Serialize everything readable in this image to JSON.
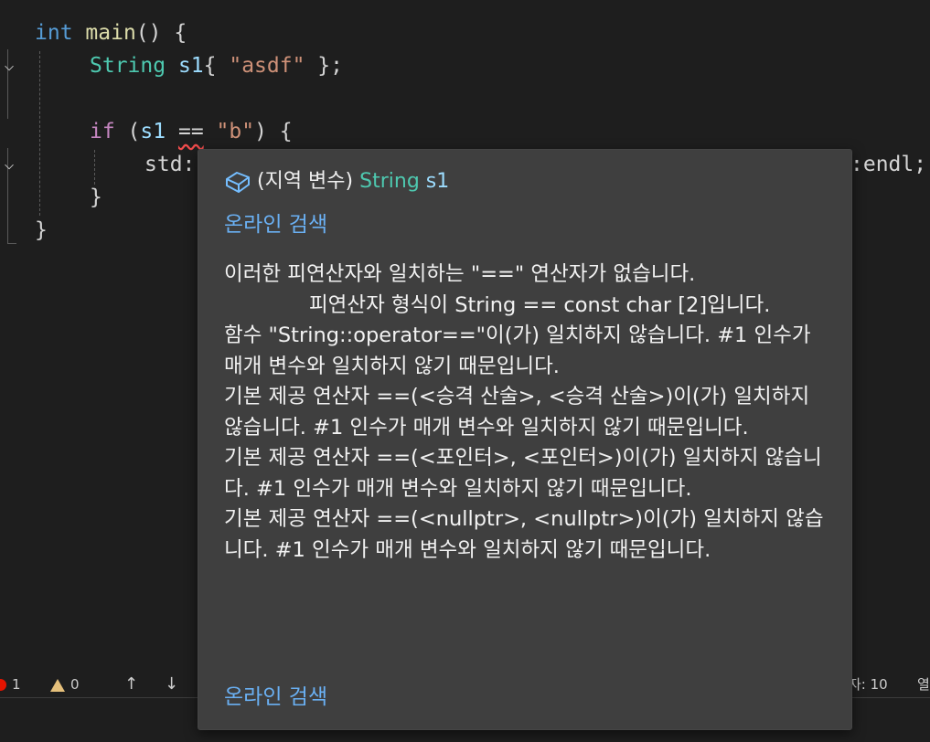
{
  "code": {
    "l1": {
      "kw": "int",
      "fn": "main",
      "rest": "() {"
    },
    "l2": {
      "type": "String",
      "var": "s1",
      "open": "{ ",
      "str": "\"asdf\"",
      "close": " };"
    },
    "l4": {
      "kw": "if",
      "open": " (",
      "var": "s1",
      "sp": " ",
      "op": "==",
      "sp2": " ",
      "str": "\"b\"",
      "close": ") {"
    },
    "l5": {
      "left": "std:",
      "right": ":endl;"
    },
    "l6": "}",
    "l7": "}"
  },
  "status": {
    "errors": "1",
    "warnings": "0",
    "up_arrow": "↑",
    "down_arrow": "↓",
    "position": "자: 10",
    "col_partial": "열"
  },
  "hover": {
    "icon": "cube-icon",
    "label": "(지역 변수)",
    "type": "String",
    "name": "s1",
    "link_top": "온라인 검색",
    "messages": [
      "이러한 피연산자와 일치하는 \"==\" 연산자가 없습니다.",
      "             피연산자 형식이 String == const char [2]입니다.",
      "함수 \"String::operator==\"이(가) 일치하지 않습니다. #1 인수가 매개 변수와 일치하지 않기 때문입니다.",
      "기본 제공 연산자 ==(<승격 산술>, <승격 산술>)이(가) 일치하지 않습니다. #1 인수가 매개 변수와 일치하지 않기 때문입니다.",
      "기본 제공 연산자 ==(<포인터>, <포인터>)이(가) 일치하지 않습니다. #1 인수가 매개 변수와 일치하지 않기 때문입니다.",
      "기본 제공 연산자 ==(<nullptr>, <nullptr>)이(가) 일치하지 않습니다. #1 인수가 매개 변수와 일치하지 않기 때문입니다."
    ],
    "link_bottom": "온라인 검색"
  },
  "colors": {
    "background": "#1e1e1e",
    "hover_bg": "#3f3f3f",
    "keyword": "#569cd6",
    "control": "#c586c0",
    "type": "#4ec9b0",
    "function": "#dcdcaa",
    "variable": "#9cdcfe",
    "string": "#ce9178",
    "link": "#6ab0f3",
    "error": "#e51400"
  }
}
